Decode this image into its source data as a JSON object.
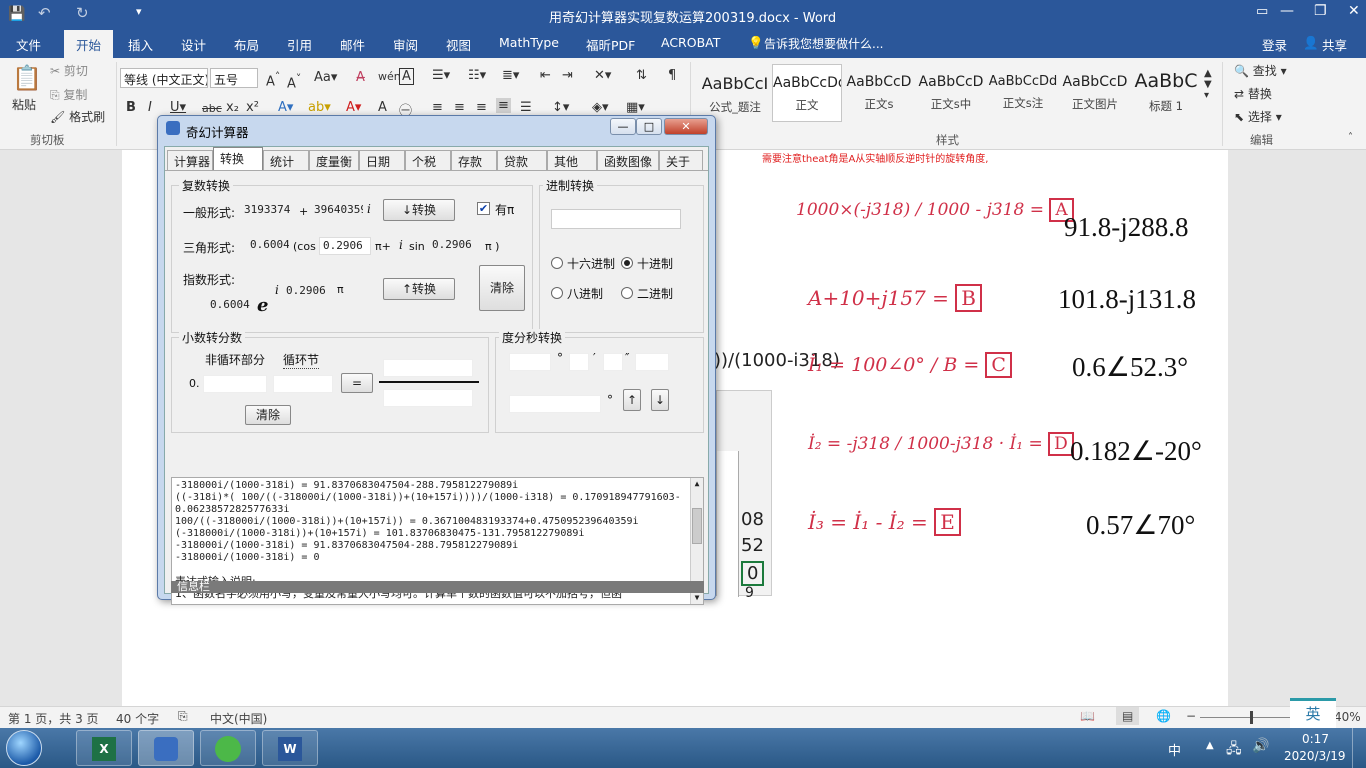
{
  "window_title": "用奇幻计算器实现复数运算200319.docx - Word",
  "ribbon_tabs": [
    "文件",
    "开始",
    "插入",
    "设计",
    "布局",
    "引用",
    "邮件",
    "审阅",
    "视图",
    "MathType",
    "福昕PDF",
    "ACROBAT"
  ],
  "tell_me": "告诉我您想要做什么...",
  "login": "登录",
  "share": "共享",
  "clipboard": {
    "paste": "粘贴",
    "cut": "剪切",
    "copy": "复制",
    "format_painter": "格式刷",
    "group": "剪切板"
  },
  "font": {
    "name": "等线 (中文正文)",
    "size": "五号"
  },
  "styles": {
    "items": [
      {
        "preview": "AaBbCcI",
        "name": "公式_题注"
      },
      {
        "preview": "AaBbCcDd",
        "name": "正文"
      },
      {
        "preview": "AaBbCcD",
        "name": "正文s"
      },
      {
        "preview": "AaBbCcD",
        "name": "正文s中"
      },
      {
        "preview": "AaBbCcDd",
        "name": "正文s注"
      },
      {
        "preview": "AaBbCcD",
        "name": "正文图片"
      },
      {
        "preview": "AaBbC",
        "name": "标题 1"
      }
    ],
    "group": "样式"
  },
  "editing": {
    "find": "查找",
    "replace": "替换",
    "select": "选择",
    "group": "编辑"
  },
  "doc": {
    "note": "需要注意theat角是A从实轴顺反逆时针的旋转角度,",
    "formula_text": "))/(1000-i318)",
    "table_cells": [
      "08",
      "52",
      "0",
      "9"
    ],
    "handwritten": [
      {
        "lhs": "1000×(-j318) / 1000 - j318",
        "label": "A",
        "answer": "91.8-j288.8"
      },
      {
        "lhs": "A+10+j157",
        "label": "B",
        "answer": "101.8-j131.8"
      },
      {
        "lhs": "İ₁ = 100∠0° / B",
        "label": "C",
        "answer": "0.6∠52.3°"
      },
      {
        "lhs": "İ₂ = -j318 / 1000-j318 · İ₁",
        "label": "D",
        "answer": "0.182∠-20°"
      },
      {
        "lhs": "İ₃ = İ₁ - İ₂",
        "label": "E",
        "answer": "0.57∠70°"
      }
    ]
  },
  "calc": {
    "title": "奇幻计算器",
    "tabs": [
      "计算器",
      "转换",
      "统计",
      "度量衡",
      "日期",
      "个税",
      "存款",
      "贷款",
      "其他",
      "函数图像",
      "关于"
    ],
    "complex": {
      "group": "复数转换",
      "general_label": "一般形式:",
      "real": "3193374",
      "plus": "+",
      "imag": "39640359",
      "i": "i",
      "convert_down": "↓转换",
      "has_pi": "有π",
      "trig_label": "三角形式:",
      "modulus": "0.6004",
      "cos": "(cos",
      "angle1": "0.2906",
      "pi_plus": "π+",
      "sin": "sin",
      "angle2": "0.2906",
      "pi_close": "π )",
      "exp_label": "指数形式:",
      "exp_modulus": "0.6004",
      "e": "e",
      "exp_angle": "0.2906",
      "pi": "π",
      "convert_up": "↑转换",
      "clear": "清除"
    },
    "base": {
      "group": "进制转换",
      "hex": "十六进制",
      "dec": "十进制",
      "oct": "八进制",
      "bin": "二进制"
    },
    "fraction": {
      "group": "小数转分数",
      "non_repeat": "非循环部分",
      "repeat": "循环节",
      "prefix": "0.",
      "eq": "=",
      "clear": "清除"
    },
    "dms": {
      "group": "度分秒转换",
      "deg": "°",
      "min": "′",
      "sec": "″",
      "deg2": "°",
      "up": "↑",
      "down": "↓"
    },
    "log": [
      "-318000i/(1000-318i) = 91.8370683047504-288.795812279089i",
      "((-318i)*( 100/((-318000i/(1000-318i))+(10+157i))))/(1000-i318) = 0.170918947791603-",
      "0.0623857282577633i",
      "100/((-318000i/(1000-318i))+(10+157i)) = 0.367100483193374+0.475095239640359i",
      "(-318000i/(1000-318i))+(10+157i)  = 101.83706830475-131.795812279089i",
      "-318000i/(1000-318i) = 91.8370683047504-288.795812279089i",
      "-318000i/(1000-318i) = 0",
      "",
      "表达式输入说明:",
      "    1、函数名字必须用小写，变量及常量大小写均可。计算单个数的函数值可以不加括号，但函"
    ],
    "info_bar": "信息栏"
  },
  "status": {
    "page": "第 1 页，共 3 页",
    "words": "40 个字",
    "lang": "中文(中国)",
    "zoom": "40%"
  },
  "taskbar": {
    "ime": "英",
    "ime2": "中",
    "time": "0:17",
    "date": "2020/3/19"
  }
}
